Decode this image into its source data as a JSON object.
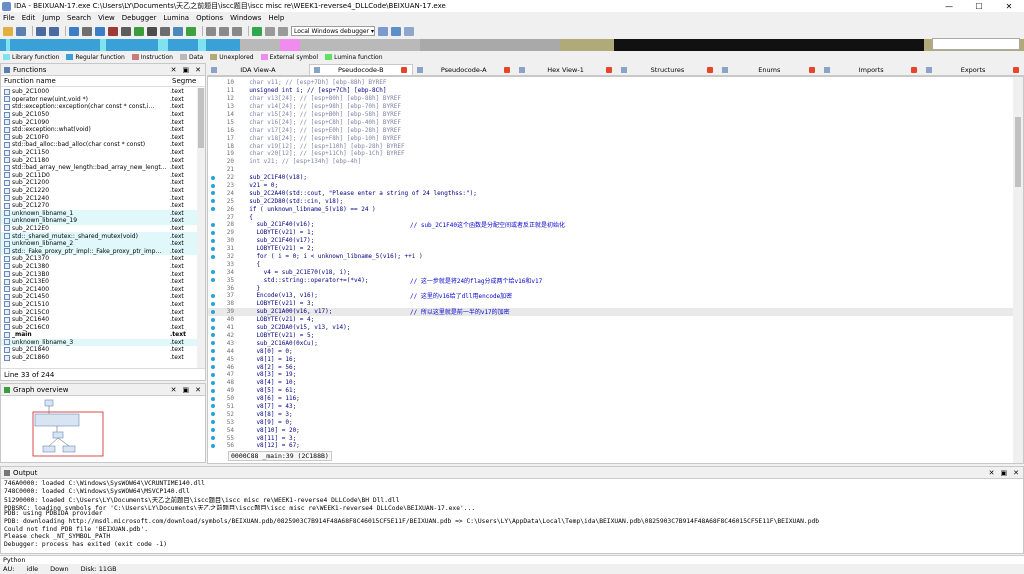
{
  "window": {
    "title": "IDA - BEIXUAN-17.exe C:\\Users\\LY\\Documents\\天乙之前题目\\iscc题目\\iscc misc re\\WEEK1-reverse4_DLLCode\\BEIXUAN-17.exe",
    "minimize": "—",
    "maximize": "☐",
    "close": "✕"
  },
  "menu": [
    "File",
    "Edit",
    "Jump",
    "Search",
    "View",
    "Debugger",
    "Lumina",
    "Options",
    "Windows",
    "Help"
  ],
  "toolbar": {
    "debugger_select": "Local Windows debugger"
  },
  "legend": [
    {
      "label": "Library function",
      "color": "#7fe3ef"
    },
    {
      "label": "Regular function",
      "color": "#3aa0d8"
    },
    {
      "label": "Instruction",
      "color": "#c97a7a"
    },
    {
      "label": "Data",
      "color": "#b9b9b9"
    },
    {
      "label": "Unexplored",
      "color": "#b0aa78"
    },
    {
      "label": "External symbol",
      "color": "#f08cf0"
    },
    {
      "label": "Lumina function",
      "color": "#62e062"
    }
  ],
  "functions_panel": {
    "title": "Functions",
    "col_name": "Function name",
    "col_segment": "Segme",
    "status": "Line 33 of 244",
    "rows": [
      {
        "name": "sub_2C1000",
        "seg": ".text",
        "lib": false
      },
      {
        "name": "operator new(uint,void *)",
        "seg": ".text",
        "lib": false
      },
      {
        "name": "std::exception::exception(char const * const,i…",
        "seg": ".text",
        "lib": false
      },
      {
        "name": "sub_2C1050",
        "seg": ".text",
        "lib": false
      },
      {
        "name": "sub_2C1090",
        "seg": ".text",
        "lib": false
      },
      {
        "name": "std::exception::what(void)",
        "seg": ".text",
        "lib": false
      },
      {
        "name": "sub_2C10F0",
        "seg": ".text",
        "lib": false
      },
      {
        "name": "std::bad_alloc::bad_alloc(char const * const)",
        "seg": ".text",
        "lib": false
      },
      {
        "name": "sub_2C1150",
        "seg": ".text",
        "lib": false
      },
      {
        "name": "sub_2C1180",
        "seg": ".text",
        "lib": false
      },
      {
        "name": "std::bad_array_new_length::bad_array_new_lengt…",
        "seg": ".text",
        "lib": false
      },
      {
        "name": "sub_2C11D0",
        "seg": ".text",
        "lib": false
      },
      {
        "name": "sub_2C1200",
        "seg": ".text",
        "lib": false
      },
      {
        "name": "sub_2C1220",
        "seg": ".text",
        "lib": false
      },
      {
        "name": "sub_2C1240",
        "seg": ".text",
        "lib": false
      },
      {
        "name": "sub_2C1270",
        "seg": ".text",
        "lib": false
      },
      {
        "name": "unknown_libname_1",
        "seg": ".text",
        "lib": true
      },
      {
        "name": "unknown_libname_19",
        "seg": ".text",
        "lib": true
      },
      {
        "name": "sub_2C12E0",
        "seg": ".text",
        "lib": false
      },
      {
        "name": "std::_shared_mutex::_shared_mutex(void)",
        "seg": ".text",
        "lib": true
      },
      {
        "name": "unknown_libname_2",
        "seg": ".text",
        "lib": true
      },
      {
        "name": "std::_Fake_proxy_ptr_impl::_Fake_proxy_ptr_imp…",
        "seg": ".text",
        "lib": true
      },
      {
        "name": "sub_2C1370",
        "seg": ".text",
        "lib": false
      },
      {
        "name": "sub_2C1380",
        "seg": ".text",
        "lib": false
      },
      {
        "name": "sub_2C13B0",
        "seg": ".text",
        "lib": false
      },
      {
        "name": "sub_2C13E0",
        "seg": ".text",
        "lib": false
      },
      {
        "name": "sub_2C1400",
        "seg": ".text",
        "lib": false
      },
      {
        "name": "sub_2C1450",
        "seg": ".text",
        "lib": false
      },
      {
        "name": "sub_2C1510",
        "seg": ".text",
        "lib": false
      },
      {
        "name": "sub_2C15C0",
        "seg": ".text",
        "lib": false
      },
      {
        "name": "sub_2C1640",
        "seg": ".text",
        "lib": false
      },
      {
        "name": "sub_2C16C0",
        "seg": ".text",
        "lib": false
      },
      {
        "name": "_main",
        "seg": ".text",
        "lib": false,
        "main": true
      },
      {
        "name": "unknown_libname_3",
        "seg": ".text",
        "lib": true
      },
      {
        "name": "sub_2C1840",
        "seg": ".text",
        "lib": false
      },
      {
        "name": "sub_2C1860",
        "seg": ".text",
        "lib": false
      }
    ]
  },
  "graph_panel": {
    "title": "Graph overview"
  },
  "tabs": [
    {
      "label": "IDA View-A",
      "active": false,
      "closable": false
    },
    {
      "label": "Pseudocode-B",
      "active": true,
      "closable": true
    },
    {
      "label": "Pseudocode-A",
      "active": false,
      "closable": true
    },
    {
      "label": "Hex View-1",
      "active": false,
      "closable": true
    },
    {
      "label": "Structures",
      "active": false,
      "closable": true
    },
    {
      "label": "Enums",
      "active": false,
      "closable": true
    },
    {
      "label": "Imports",
      "active": false,
      "closable": true
    },
    {
      "label": "Exports",
      "active": false,
      "closable": true
    }
  ],
  "code": {
    "lines": [
      {
        "n": "10",
        "dot": false,
        "grey": true,
        "code": "  char v11; // [esp+7Dh] [ebp-8Bh] BYREF",
        "comment": ""
      },
      {
        "n": "11",
        "dot": false,
        "grey": false,
        "code": "  unsigned int i; // [esp+7Ch] [ebp-8Ch]",
        "comment": ""
      },
      {
        "n": "12",
        "dot": false,
        "grey": true,
        "code": "  char v13[24]; // [esp+80h] [ebp-88h] BYREF",
        "comment": ""
      },
      {
        "n": "13",
        "dot": false,
        "grey": true,
        "code": "  char v14[24]; // [esp+98h] [ebp-70h] BYREF",
        "comment": ""
      },
      {
        "n": "14",
        "dot": false,
        "grey": true,
        "code": "  char v15[24]; // [esp+B0h] [ebp-58h] BYREF",
        "comment": ""
      },
      {
        "n": "15",
        "dot": false,
        "grey": true,
        "code": "  char v16[24]; // [esp+C8h] [ebp-40h] BYREF",
        "comment": ""
      },
      {
        "n": "16",
        "dot": false,
        "grey": true,
        "code": "  char v17[24]; // [esp+E0h] [ebp-28h] BYREF",
        "comment": ""
      },
      {
        "n": "17",
        "dot": false,
        "grey": true,
        "code": "  char v18[24]; // [esp+F8h] [ebp-10h] BYREF",
        "comment": ""
      },
      {
        "n": "18",
        "dot": false,
        "grey": true,
        "code": "  char v19[12]; // [esp+110h] [ebp-28h] BYREF",
        "comment": ""
      },
      {
        "n": "19",
        "dot": false,
        "grey": true,
        "code": "  char v20[12]; // [esp+11Ch] [ebp-1Ch] BYREF",
        "comment": ""
      },
      {
        "n": "20",
        "dot": false,
        "grey": true,
        "code": "  int v21; // [esp+134h] [ebp-4h]",
        "comment": ""
      },
      {
        "n": "21",
        "dot": false,
        "grey": false,
        "code": "",
        "comment": ""
      },
      {
        "n": "22",
        "dot": true,
        "grey": false,
        "code": "  sub_2C1F40(v18);",
        "comment": ""
      },
      {
        "n": "23",
        "dot": true,
        "grey": false,
        "code": "  v21 = 0;",
        "comment": ""
      },
      {
        "n": "24",
        "dot": true,
        "grey": false,
        "code": "  sub_2C2A40(std::cout, \"Please enter a string of 24 lengthss:\");",
        "comment": ""
      },
      {
        "n": "25",
        "dot": true,
        "grey": false,
        "code": "  sub_2C2D80(std::cin, v18);",
        "comment": ""
      },
      {
        "n": "26",
        "dot": true,
        "grey": false,
        "code": "  if ( unknown_libname_5(v18) == 24 )",
        "comment": ""
      },
      {
        "n": "27",
        "dot": false,
        "grey": false,
        "code": "  {",
        "comment": ""
      },
      {
        "n": "28",
        "dot": true,
        "grey": false,
        "code": "    sub_2C1F40(v16);",
        "comment": "// sub_2C1F40这个函数是分配空间或者反正就是初始化"
      },
      {
        "n": "29",
        "dot": true,
        "grey": false,
        "code": "    LOBYTE(v21) = 1;",
        "comment": ""
      },
      {
        "n": "30",
        "dot": true,
        "grey": false,
        "code": "    sub_2C1F40(v17);",
        "comment": ""
      },
      {
        "n": "31",
        "dot": true,
        "grey": false,
        "code": "    LOBYTE(v21) = 2;",
        "comment": ""
      },
      {
        "n": "32",
        "dot": true,
        "grey": false,
        "code": "    for ( i = 0; i < unknown_libname_5(v16); ++i )",
        "comment": ""
      },
      {
        "n": "33",
        "dot": false,
        "grey": false,
        "code": "    {",
        "comment": ""
      },
      {
        "n": "34",
        "dot": true,
        "grey": false,
        "code": "      v4 = sub_2C1E70(v18, i);",
        "comment": ""
      },
      {
        "n": "35",
        "dot": true,
        "grey": false,
        "code": "      std::string::operator+=(*v4);",
        "comment": "// 这一步就是将24的flag分成两个给v16和v17"
      },
      {
        "n": "36",
        "dot": false,
        "grey": false,
        "code": "    }",
        "comment": ""
      },
      {
        "n": "37",
        "dot": true,
        "grey": false,
        "code": "    Encode(v13, v16);",
        "comment": "// 这里的v16给了dll用encode加密"
      },
      {
        "n": "38",
        "dot": true,
        "grey": false,
        "code": "    LOBYTE(v21) = 3;",
        "comment": ""
      },
      {
        "n": "39",
        "dot": true,
        "grey": false,
        "code": "    sub_2C1A00(v16, v17);",
        "comment": "// 所以这里就是前一半的v17的加密",
        "hl": true
      },
      {
        "n": "40",
        "dot": true,
        "grey": false,
        "code": "    LOBYTE(v21) = 4;",
        "comment": ""
      },
      {
        "n": "41",
        "dot": true,
        "grey": false,
        "code": "    sub_2C2DA0(v15, v13, v14);",
        "comment": ""
      },
      {
        "n": "42",
        "dot": true,
        "grey": false,
        "code": "    LOBYTE(v21) = 5;",
        "comment": ""
      },
      {
        "n": "43",
        "dot": true,
        "grey": false,
        "code": "    sub_2C16A0(0xCu);",
        "comment": ""
      },
      {
        "n": "44",
        "dot": true,
        "grey": false,
        "code": "    v8[0] = 0;",
        "comment": ""
      },
      {
        "n": "45",
        "dot": true,
        "grey": false,
        "code": "    v8[1] = 16;",
        "comment": ""
      },
      {
        "n": "46",
        "dot": true,
        "grey": false,
        "code": "    v8[2] = 56;",
        "comment": ""
      },
      {
        "n": "47",
        "dot": true,
        "grey": false,
        "code": "    v8[3] = 19;",
        "comment": ""
      },
      {
        "n": "48",
        "dot": true,
        "grey": false,
        "code": "    v8[4] = 10;",
        "comment": ""
      },
      {
        "n": "49",
        "dot": true,
        "grey": false,
        "code": "    v8[5] = 61;",
        "comment": ""
      },
      {
        "n": "50",
        "dot": true,
        "grey": false,
        "code": "    v8[6] = 116;",
        "comment": ""
      },
      {
        "n": "51",
        "dot": true,
        "grey": false,
        "code": "    v8[7] = 43;",
        "comment": ""
      },
      {
        "n": "52",
        "dot": true,
        "grey": false,
        "code": "    v8[8] = 3;",
        "comment": ""
      },
      {
        "n": "53",
        "dot": true,
        "grey": false,
        "code": "    v8[9] = 0;",
        "comment": ""
      },
      {
        "n": "54",
        "dot": true,
        "grey": false,
        "code": "    v8[10] = 20;",
        "comment": ""
      },
      {
        "n": "55",
        "dot": true,
        "grey": false,
        "code": "    v8[11] = 3;",
        "comment": ""
      },
      {
        "n": "56",
        "dot": true,
        "grey": false,
        "code": "    v8[12] = 67;",
        "comment": ""
      }
    ],
    "status": "0000C88 _main:39 (2C188B)"
  },
  "output_panel": {
    "title": "Output",
    "lines": [
      "746A0000: loaded C:\\Windows\\SysWOW64\\VCRUNTIME140.dll",
      "748C0000: loaded C:\\Windows\\SysWOW64\\MSVCP140.dll",
      "51290000: loaded C:\\Users\\LY\\Documents\\天乙之前题目\\iscc题目\\iscc misc re\\WEEK1-reverse4_DLLCode\\BH_Dll.dll",
      "PDBSRC: loading symbols for 'C:\\Users\\LY\\Documents\\天乙之前题目\\iscc题目\\iscc misc re\\WEEK1-reverse4_DLLCode\\BEIXUAN-17.exe'...",
      "PDB: using PDBIDA provider",
      "PDB: downloading http://msdl.microsoft.com/download/symbols/BEIXUAN.pdb/0825903C7B914F48A68F8C46015CF5E11F/BEIXUAN.pdb => C:\\Users\\LY\\AppData\\Local\\Temp\\ida\\BEIXUAN.pdb\\0825903C7B914F48A68F8C46015CF5E11F\\BEIXUAN.pdb",
      "Could not find PDB file 'BEIXUAN.pdb'.",
      "Please check _NT_SYMBOL_PATH",
      "Debugger: process has exited (exit code -1)"
    ]
  },
  "python_bar": "Python",
  "statusbar": {
    "au": "AU:",
    "state": "idle",
    "direction": "Down",
    "disk": "Disk: 11GB"
  }
}
